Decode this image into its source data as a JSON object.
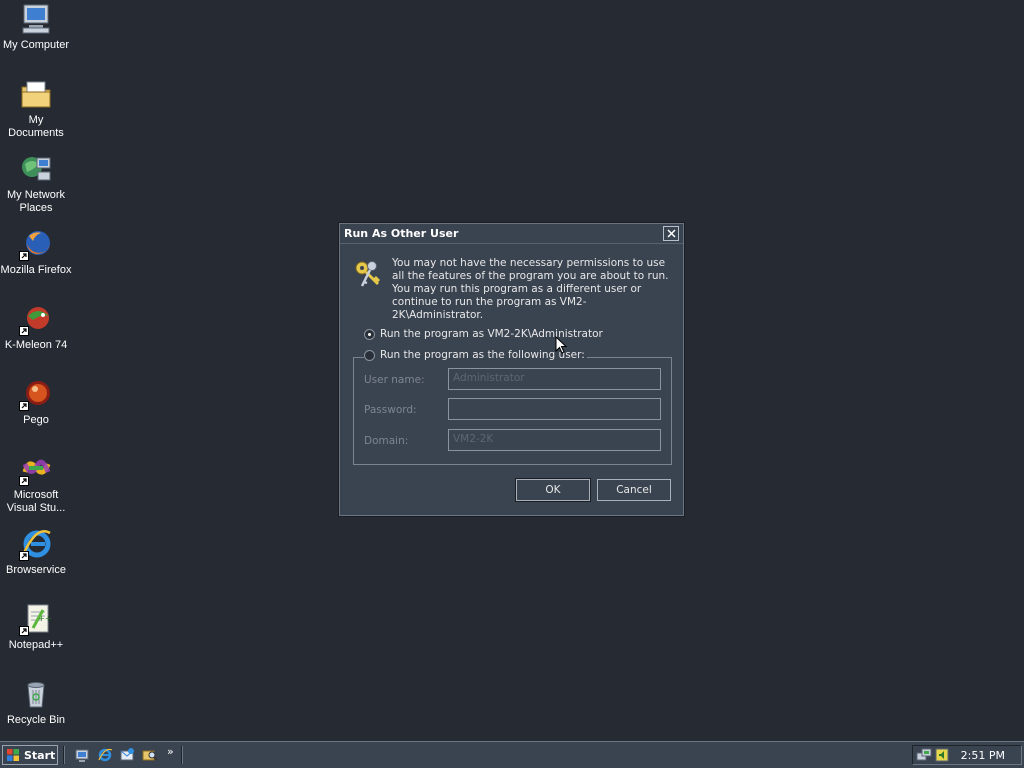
{
  "desktop": {
    "icons": [
      {
        "label": "My Computer",
        "icon": "computer-icon"
      },
      {
        "label": "My Documents",
        "icon": "folder-documents-icon"
      },
      {
        "label": "My Network Places",
        "icon": "network-places-icon"
      },
      {
        "label": "Mozilla Firefox",
        "icon": "firefox-icon"
      },
      {
        "label": "K-Meleon 74",
        "icon": "k-meleon-icon"
      },
      {
        "label": "Pego",
        "icon": "pego-icon"
      },
      {
        "label": "Microsoft Visual Stu...",
        "icon": "visual-studio-icon"
      },
      {
        "label": "Browservice",
        "icon": "internet-explorer-icon"
      },
      {
        "label": "Notepad++",
        "icon": "notepad-plus-icon"
      },
      {
        "label": "Recycle Bin",
        "icon": "recycle-bin-icon"
      }
    ]
  },
  "dialog": {
    "title": "Run As Other User",
    "message": "You may not have the necessary permissions to use all the features of the program you are about to run.  You may run this program as a different user or continue to run the program as VM2-2K\\Administrator.",
    "option_current": "Run the program as VM2-2K\\Administrator",
    "option_other": "Run the program as the following user:",
    "selected_option": "current",
    "fields": {
      "username_label": "User name:",
      "username_value": "Administrator",
      "password_label": "Password:",
      "password_value": "",
      "domain_label": "Domain:",
      "domain_value": "VM2-2K"
    },
    "ok_label": "OK",
    "cancel_label": "Cancel"
  },
  "taskbar": {
    "start_label": "Start",
    "quick_launch": [
      "show-desktop-icon",
      "internet-explorer-icon",
      "outlook-express-icon",
      "search-icon"
    ],
    "overflow_label": "»",
    "tray_icons": [
      "network-tray-icon",
      "volume-tray-icon"
    ],
    "clock": "2:51 PM"
  },
  "colors": {
    "desktop": "#252a33",
    "window": "#3a4350",
    "text": "#e8e8e8",
    "disabled_text": "#7d8591"
  }
}
